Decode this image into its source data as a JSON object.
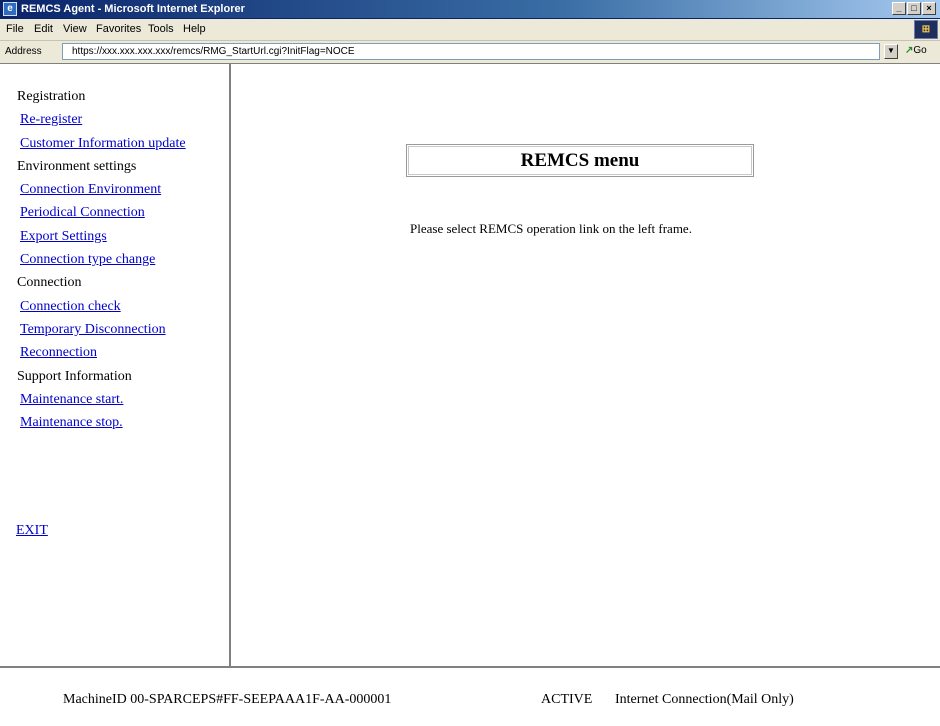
{
  "window": {
    "title": "REMCS Agent - Microsoft Internet Explorer",
    "icon": "ie-icon",
    "controls": {
      "minimize": "_",
      "maximize": "□",
      "close": "×"
    }
  },
  "menubar": {
    "items": [
      "File",
      "Edit",
      "View",
      "Favorites",
      "Tools",
      "Help"
    ]
  },
  "address_bar": {
    "label": "Address",
    "url": "https://xxx.xxx.xxx.xxx/remcs/RMG_StartUrl.cgi?InitFlag=NOCE",
    "go_label": "Go"
  },
  "nav": {
    "sections": [
      {
        "heading": "Registration",
        "links": [
          "Re-register",
          "Customer Information update"
        ]
      },
      {
        "heading": "Environment settings",
        "links": [
          "Connection Environment",
          "Periodical Connection",
          "Export Settings",
          "Connection type change"
        ]
      },
      {
        "heading": "Connection",
        "links": [
          "Connection check",
          "Temporary Disconnection",
          "Reconnection"
        ]
      },
      {
        "heading": "Support Information",
        "links": [
          "Maintenance start.",
          "Maintenance stop."
        ]
      }
    ],
    "exit_label": "EXIT"
  },
  "main": {
    "menu_title": "REMCS menu",
    "instruction": "Please select REMCS operation link on the left frame."
  },
  "status": {
    "machine_id": "MachineID  00-SPARCEPS#FF-SEEPAAA1F-AA-000001",
    "state": "ACTIVE",
    "connection": "Internet Connection(Mail Only)"
  }
}
